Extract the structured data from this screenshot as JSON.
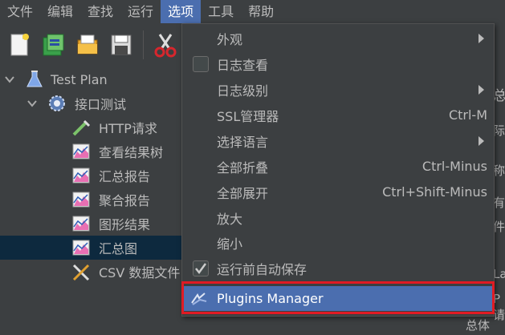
{
  "menubar": {
    "items": [
      "文件",
      "编辑",
      "查找",
      "运行",
      "选项",
      "工具",
      "帮助"
    ],
    "active_index": 4
  },
  "toolbar": {
    "buttons": [
      "new-icon",
      "templates-icon",
      "open-icon",
      "save-icon",
      "cut-icon"
    ]
  },
  "tree": {
    "items": [
      {
        "label": "Test Plan",
        "icon": "flask-icon"
      },
      {
        "label": "接口测试",
        "icon": "gear-icon"
      },
      {
        "label": "HTTP请求",
        "icon": "pipette-icon"
      },
      {
        "label": "查看结果树",
        "icon": "chart-icon"
      },
      {
        "label": "汇总报告",
        "icon": "chart-icon"
      },
      {
        "label": "聚合报告",
        "icon": "chart-icon"
      },
      {
        "label": "图形结果",
        "icon": "chart-icon"
      },
      {
        "label": "汇总图",
        "icon": "chart-icon"
      },
      {
        "label": "CSV 数据文件",
        "icon": "tools-icon"
      }
    ],
    "selected_index": 7
  },
  "right_panel": {
    "fragments": [
      "总",
      "际:",
      "称:",
      "有",
      "件",
      "La",
      "P请",
      "总体"
    ]
  },
  "options_menu": {
    "items": [
      {
        "label": "外观",
        "accel": "",
        "submenu": true,
        "checkbox": false
      },
      {
        "label": "日志查看",
        "accel": "",
        "submenu": false,
        "checkbox": true,
        "checked": false
      },
      {
        "label": "日志级别",
        "accel": "",
        "submenu": true,
        "checkbox": false
      },
      {
        "label": "SSL管理器",
        "accel": "Ctrl-M",
        "submenu": false,
        "checkbox": false
      },
      {
        "label": "选择语言",
        "accel": "",
        "submenu": true,
        "checkbox": false
      },
      {
        "label": "全部折叠",
        "accel": "Ctrl-Minus",
        "submenu": false,
        "checkbox": false
      },
      {
        "label": "全部展开",
        "accel": "Ctrl+Shift-Minus",
        "submenu": false,
        "checkbox": false
      },
      {
        "label": "放大",
        "accel": "",
        "submenu": false,
        "checkbox": false
      },
      {
        "label": "缩小",
        "accel": "",
        "submenu": false,
        "checkbox": false
      },
      {
        "label": "运行前自动保存",
        "accel": "",
        "submenu": false,
        "checkbox": true,
        "checked": true
      },
      {
        "label": "Plugins Manager",
        "accel": "",
        "submenu": false,
        "checkbox": false,
        "highlight": true
      }
    ]
  },
  "colors": {
    "background": "#3c3f41",
    "highlight": "#4b6eaf",
    "selected_row": "#0d293e",
    "annotation_red": "#e01b24"
  }
}
